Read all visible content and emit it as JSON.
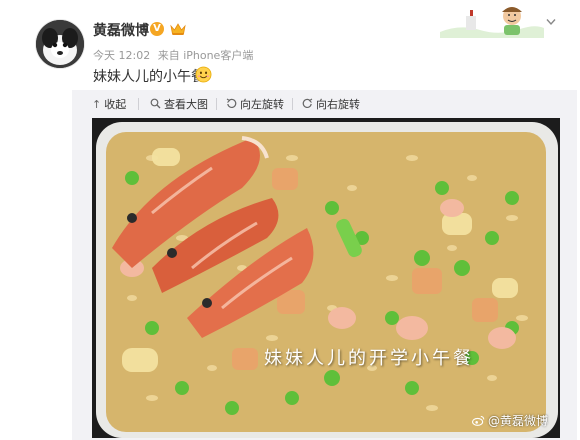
{
  "post": {
    "author": "黄磊微博",
    "verified_badge": "V",
    "time": "今天 12:02",
    "source": "来自 iPhone客户端",
    "text": "妹妹人儿的小午餐"
  },
  "toolbar": {
    "collapse_label": "收起",
    "view_large_label": "查看大图",
    "rotate_left_label": "向左旋转",
    "rotate_right_label": "向右旋转"
  },
  "photo": {
    "caption_overlay": "妹妹人儿的开学小午餐",
    "watermark": "@黄磊微博"
  },
  "colors": {
    "accent": "#f5a623",
    "text_primary": "#333333",
    "text_secondary": "#999999",
    "toolbar_bg": "#f2f2f5"
  },
  "icons": {
    "collapse": "arrow-up-icon",
    "view_large": "magnifier-icon",
    "rotate_left": "rotate-left-icon",
    "rotate_right": "rotate-right-icon",
    "weibo": "weibo-logo-icon"
  }
}
